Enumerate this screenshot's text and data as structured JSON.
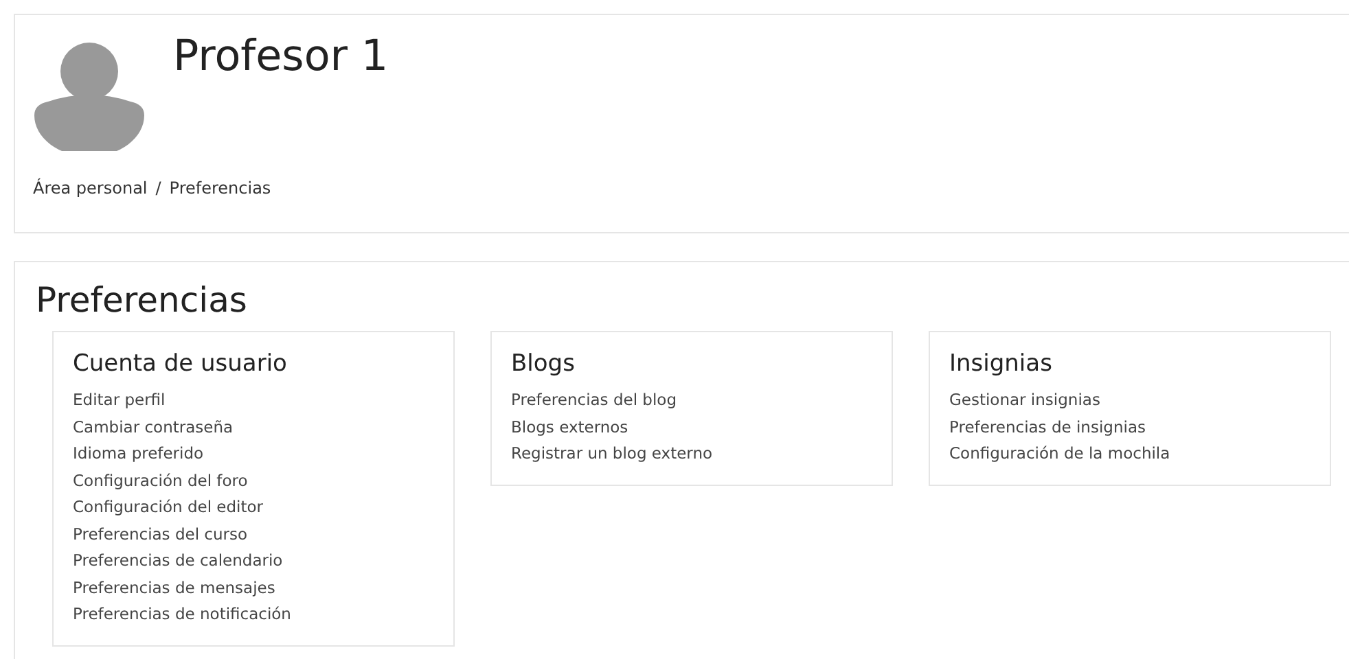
{
  "header": {
    "name": "Profesor 1",
    "breadcrumb": [
      "Área personal",
      "Preferencias"
    ],
    "separator": "/"
  },
  "page_title": "Preferencias",
  "sections": [
    {
      "title": "Cuenta de usuario",
      "links": [
        "Editar perfil",
        "Cambiar contraseña",
        "Idioma preferido",
        "Configuración del foro",
        "Configuración del editor",
        "Preferencias del curso",
        "Preferencias de calendario",
        "Preferencias de mensajes",
        "Preferencias de notificación"
      ]
    },
    {
      "title": "Blogs",
      "links": [
        "Preferencias del blog",
        "Blogs externos",
        "Registrar un blog externo"
      ]
    },
    {
      "title": "Insignias",
      "links": [
        "Gestionar insignias",
        "Preferencias de insignias",
        "Configuración de la mochila"
      ]
    }
  ]
}
